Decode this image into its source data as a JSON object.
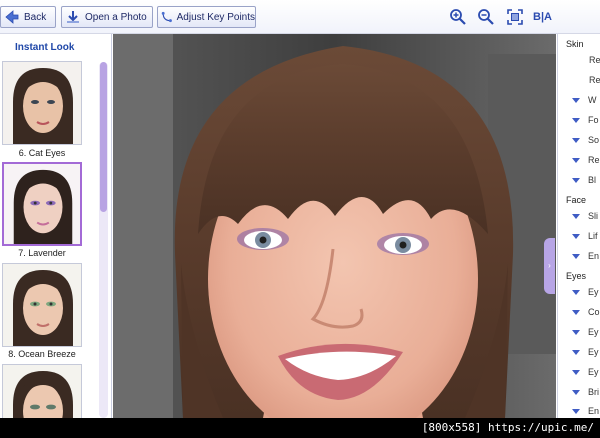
{
  "toolbar": {
    "back_label": "Back",
    "open_label": "Open a Photo",
    "adjust_label": "Adjust Key Points",
    "ba_label": "B|A"
  },
  "left_panel": {
    "title": "Instant Look",
    "thumbnails": [
      {
        "label": ""
      },
      {
        "label": "6. Cat Eyes"
      },
      {
        "label": "7. Lavender",
        "selected": true
      },
      {
        "label": "8. Ocean Breeze"
      },
      {
        "label": ""
      }
    ]
  },
  "right_panel": {
    "sections": [
      {
        "title": "Skin",
        "items": [
          "Re",
          "Re",
          "W",
          "Fo",
          "So",
          "Re",
          "Bl"
        ]
      },
      {
        "title": "Face",
        "items": [
          "Sli",
          "Lif",
          "En"
        ]
      },
      {
        "title": "Eyes",
        "items": [
          "Ey",
          "Co",
          "Ey",
          "Ey",
          "Ey",
          "Bri",
          "En"
        ]
      }
    ]
  },
  "watermark": "[800x558] https://upic.me/",
  "colors": {
    "accent": "#a36ad6",
    "link": "#1f47a8",
    "toolbar_text": "#1f2a66"
  }
}
